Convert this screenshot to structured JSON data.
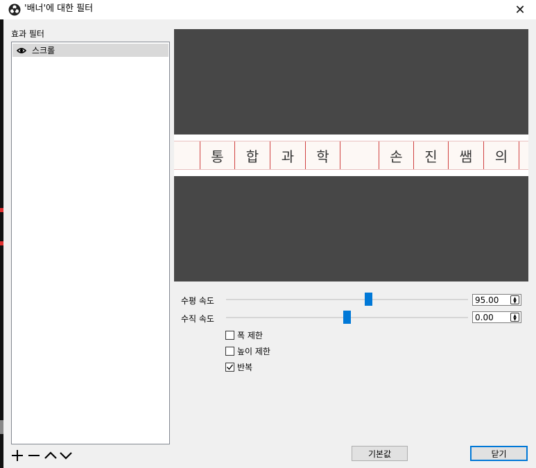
{
  "window": {
    "title": "'배너'에 대한 필터",
    "close_symbol": "✕"
  },
  "left_panel": {
    "label": "효과 필터",
    "filters": [
      {
        "label": "스크롤",
        "visible_icon": "eye-icon"
      }
    ],
    "toolbar": {
      "add_icon": "plus-icon",
      "remove_icon": "minus-icon",
      "up_icon": "chevron-up-icon",
      "down_icon": "chevron-down-icon"
    }
  },
  "preview": {
    "background_color": "#474747",
    "banner_chars": [
      "통",
      "합",
      "과",
      "학",
      "",
      "손",
      "진",
      "쌤",
      "의",
      ""
    ]
  },
  "controls": {
    "horizontal_speed": {
      "label": "수평 속도",
      "value": "95.00",
      "slider_fraction": 0.59
    },
    "vertical_speed": {
      "label": "수직 속도",
      "value": "0.00",
      "slider_fraction": 0.5
    },
    "checkboxes": [
      {
        "label": "폭 제한",
        "checked": false
      },
      {
        "label": "높이 제한",
        "checked": false
      },
      {
        "label": "반복",
        "checked": true
      }
    ]
  },
  "buttons": {
    "defaults_label": "기본값",
    "close_label": "닫기"
  },
  "colors": {
    "accent": "#0078d7",
    "banner_border": "#d04040"
  }
}
